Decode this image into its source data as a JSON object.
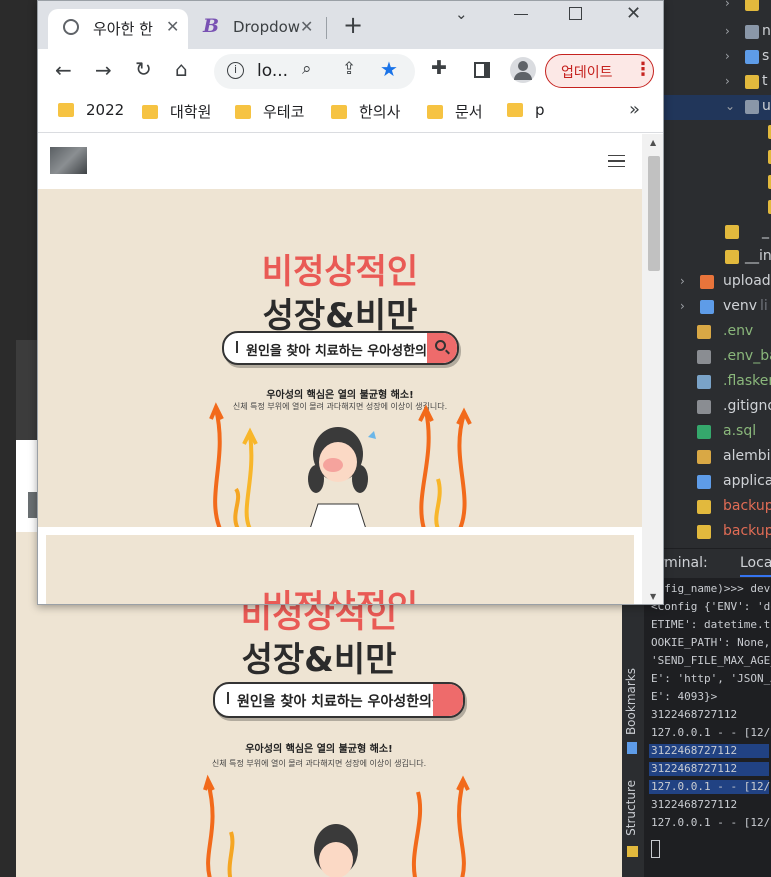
{
  "browser": {
    "tabs": [
      {
        "title": "우아한 한",
        "active": true
      },
      {
        "title": "Dropdow",
        "active": false
      }
    ],
    "new_tab_label": "+",
    "address": "lo...",
    "update_button": "업데이트",
    "bookmarks": [
      "2022",
      "대학원",
      "우테코",
      "한의사",
      "문서",
      "p"
    ],
    "bookmarks_more": "»"
  },
  "site": {
    "hero_title_line1": "비정상적인",
    "hero_title_line2": "성장&비만",
    "search_text": "원인을 찾아 치료하는 우아성한의원",
    "tagline_bold": "우아성의 핵심은 열의 불균형 해소!",
    "tagline_small": "신체 특정 부위에 열이 몰려 과다해지면 성장에 이상이 생깁니다."
  },
  "ide": {
    "tree": [
      {
        "label": "",
        "chev": "›"
      },
      {
        "label": "n",
        "chev": "›"
      },
      {
        "label": "s",
        "chev": "›"
      },
      {
        "label": "t",
        "chev": "›"
      },
      {
        "label": "u",
        "chev": "⌄"
      },
      {
        "label": "",
        "chev": ""
      },
      {
        "label": "",
        "chev": ""
      },
      {
        "label": "",
        "chev": ""
      },
      {
        "label": "",
        "chev": ""
      },
      {
        "label": "_",
        "chev": ""
      },
      {
        "label": "__in",
        "chev": ""
      },
      {
        "label": "upload",
        "chev": "›"
      },
      {
        "label": "venv",
        "chev": "›"
      },
      {
        "label": ".env",
        "chev": ""
      },
      {
        "label": ".env_ba",
        "chev": ""
      },
      {
        "label": ".flasker",
        "chev": ""
      },
      {
        "label": ".gitigno",
        "chev": ""
      },
      {
        "label": "a.sql",
        "chev": ""
      },
      {
        "label": "alembic",
        "chev": ""
      },
      {
        "label": "applica",
        "chev": ""
      },
      {
        "label": "backup",
        "chev": ""
      },
      {
        "label": "backup",
        "chev": ""
      }
    ],
    "venv_suffix": "li",
    "terminal_label": "erminal:",
    "terminal_tab": "Loca",
    "side_labels": [
      "Bookmarks",
      "Structure"
    ],
    "terminal_lines": [
      "onfig_name)>>> deve",
      "<Config {'ENV': 'de",
      "ETIME': datetime.tim",
      "OOKIE_PATH': None, ",
      "'SEND_FILE_MAX_AGE_",
      "E': 'http', 'JSON_A",
      "E': 4093}>",
      "3122468727112",
      "127.0.0.1 - - [12/D",
      "3122468727112",
      "3122468727112",
      "127.0.0.1 - - [12/D",
      "3122468727112",
      "127.0.0.1 - - [12/D"
    ]
  },
  "colors": {
    "accent_red": "#e95a55",
    "hero_bg": "#eee4d3",
    "search_btn": "#ee6b6b",
    "chrome_blue": "#1a73e8",
    "update_red": "#c5221f"
  }
}
